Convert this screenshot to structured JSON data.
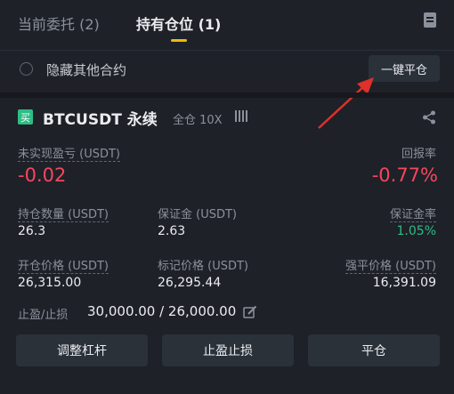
{
  "tabs": [
    {
      "label": "当前委托 (2)"
    },
    {
      "label": "持有仓位 (1)"
    }
  ],
  "filter": {
    "hide_label": "隐藏其他合约",
    "close_all_label": "一键平仓"
  },
  "position": {
    "side_badge": "买",
    "symbol": "BTCUSDT 永续",
    "margin_mode": "全仓 10X",
    "unrealized_pnl_label": "未实现盈亏 (USDT)",
    "unrealized_pnl": "-0.02",
    "roe_label": "回报率",
    "roe": "-0.77%",
    "size_label": "持仓数量 (USDT)",
    "size": "26.3",
    "margin_label": "保证金 (USDT)",
    "margin": "2.63",
    "margin_ratio_label": "保证金率",
    "margin_ratio": "1.05%",
    "entry_price_label": "开仓价格 (USDT)",
    "entry_price": "26,315.00",
    "mark_price_label": "标记价格 (USDT)",
    "mark_price": "26,295.44",
    "liq_price_label": "强平价格 (USDT)",
    "liq_price": "16,391.09",
    "tpsl_label": "止盈/止损",
    "tpsl_value": "30,000.00 / 26,000.00"
  },
  "actions": {
    "adjust_leverage": "调整杠杆",
    "tpsl": "止盈止损",
    "close": "平仓"
  },
  "colors": {
    "accent": "#f0b90b",
    "negative": "#f6465d",
    "positive": "#2ebd85",
    "annotation": "#e0302a"
  },
  "icons": [
    "document-icon",
    "share-icon",
    "edit-icon",
    "level-bars-icon"
  ]
}
